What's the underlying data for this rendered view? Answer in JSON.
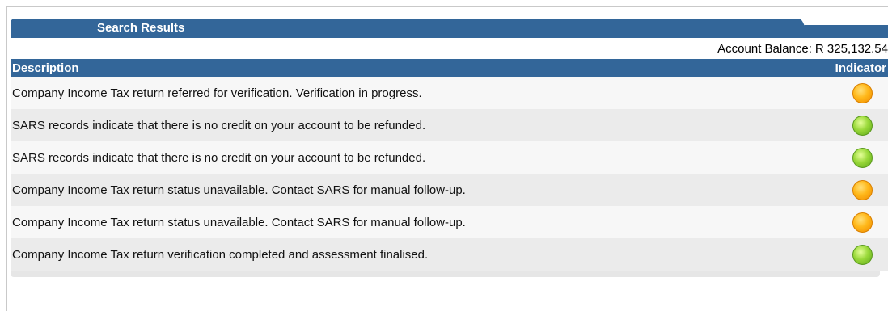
{
  "panel": {
    "title": "Search Results",
    "balance_label": "Account Balance:",
    "balance_value": "R 325,132.54"
  },
  "table": {
    "columns": [
      "Description",
      "Indicator"
    ],
    "rows": [
      {
        "description": "Company Income Tax return referred for verification. Verification in progress.",
        "indicator": "orange"
      },
      {
        "description": "SARS records indicate that there is no credit on your account to be refunded.",
        "indicator": "green"
      },
      {
        "description": "SARS records indicate that there is no credit on your account to be refunded.",
        "indicator": "green"
      },
      {
        "description": "Company Income Tax return status unavailable. Contact SARS for manual follow-up.",
        "indicator": "orange"
      },
      {
        "description": "Company Income Tax return status unavailable. Contact SARS for manual follow-up.",
        "indicator": "orange"
      },
      {
        "description": "Company Income Tax return verification completed and assessment finalised.",
        "indicator": "green"
      }
    ]
  },
  "colors": {
    "header_bg": "#336699",
    "indicator_orange": "#ffb81a",
    "indicator_green": "#9ad93a"
  }
}
